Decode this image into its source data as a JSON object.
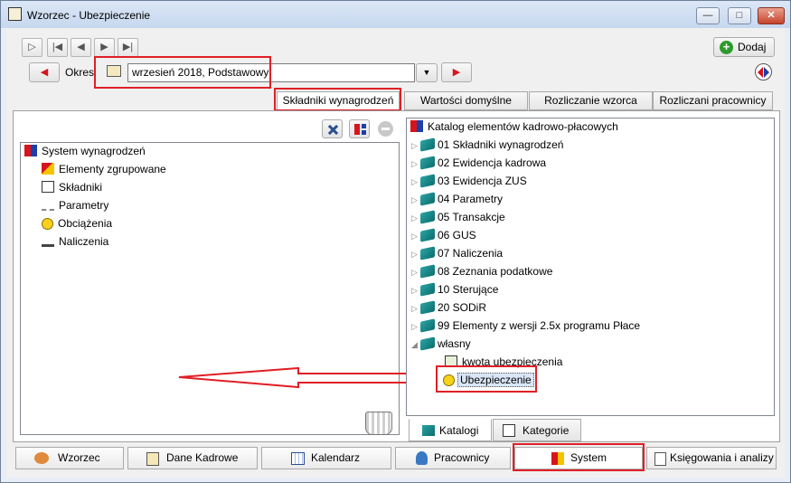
{
  "window": {
    "title": "Wzorzec - Ubezpieczenie"
  },
  "toolbar": {
    "add_label": "Dodaj"
  },
  "period": {
    "label": "Okres",
    "value": "wrzesień 2018, Podstawowy"
  },
  "tabs": [
    {
      "label": "Składniki wynagrodzeń"
    },
    {
      "label": "Wartości domyślne"
    },
    {
      "label": "Rozliczanie wzorca"
    },
    {
      "label": "Rozliczani pracownicy"
    }
  ],
  "left_tree": {
    "root": "System wynagrodzeń",
    "items": [
      {
        "label": "Elementy zgrupowane"
      },
      {
        "label": "Składniki"
      },
      {
        "label": "Parametry"
      },
      {
        "label": "Obciążenia"
      },
      {
        "label": "Naliczenia"
      }
    ]
  },
  "right_tree": {
    "root": "Katalog elementów kadrowo-płacowych",
    "items": [
      {
        "label": "01 Składniki wynagrodzeń"
      },
      {
        "label": "02 Ewidencja kadrowa"
      },
      {
        "label": "03 Ewidencja ZUS"
      },
      {
        "label": "04 Parametry"
      },
      {
        "label": "05 Transakcje"
      },
      {
        "label": "06 GUS"
      },
      {
        "label": "07 Naliczenia"
      },
      {
        "label": "08 Zeznania podatkowe"
      },
      {
        "label": "10 Sterujące"
      },
      {
        "label": "20 SODiR"
      },
      {
        "label": "99 Elementy z wersji 2.5x programu Płace"
      },
      {
        "label": "własny"
      }
    ],
    "children": [
      {
        "label": "kwota ubezpieczenia"
      },
      {
        "label": "Ubezpieczenie"
      }
    ]
  },
  "right_tabs": [
    {
      "label": "Katalogi"
    },
    {
      "label": "Kategorie"
    }
  ],
  "bottom_tabs": [
    {
      "label": "Wzorzec"
    },
    {
      "label": "Dane Kadrowe"
    },
    {
      "label": "Kalendarz"
    },
    {
      "label": "Pracownicy"
    },
    {
      "label": "System"
    },
    {
      "label": "Księgowania i analizy"
    }
  ],
  "colors": {
    "annotation_red": "#e01f26",
    "accent_red": "#d6141d"
  }
}
